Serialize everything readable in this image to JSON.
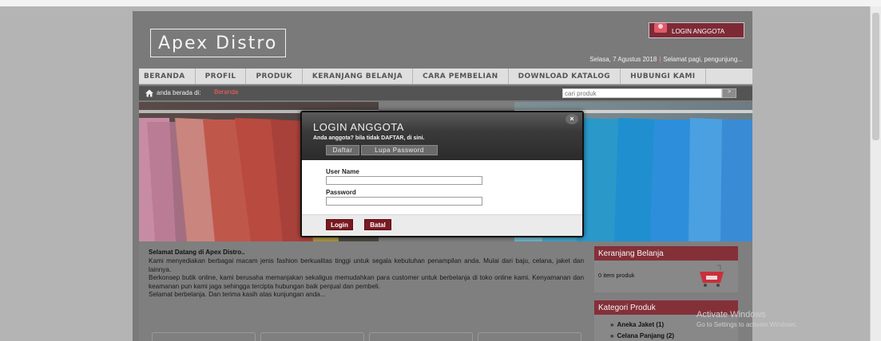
{
  "header": {
    "logo_text": "Apex Distro",
    "login_link": "LOGIN ANGGOTA",
    "date_text": "Selasa, 7 Agustus 2018",
    "greeting": "Selamat pagi, pengunjung..."
  },
  "nav": {
    "items": [
      "BERANDA",
      "PROFIL",
      "PRODUK",
      "KERANJANG BELANJA",
      "CARA PEMBELIAN",
      "DOWNLOAD KATALOG",
      "HUBUNGI KAMI"
    ]
  },
  "breadcrumb": {
    "label": "anda berada di:",
    "current": "Beranda"
  },
  "search": {
    "placeholder": "cari produk",
    "button": ">"
  },
  "modal": {
    "title": "LOGIN ANGGOTA",
    "subtitle": "Anda anggota? bila tidak DAFTAR, di sini.",
    "tab_daftar": "Daftar",
    "tab_lupa": "Lupa Password",
    "close": "×",
    "username_label": "User Name",
    "password_label": "Password",
    "login_button": "Login",
    "cancel_button": "Batal"
  },
  "welcome": {
    "title": "Selamat Datang di  Apex Distro..",
    "p1": "Kami menyediakan berbagai macam jenis fashion berkualitas tinggi untuk segala kebutuhan penampilan anda. Mulai dari baju, celana, jaket dan lainnya.",
    "p2": "Berkonsep butik online, kami berusaha memanjakan sekaligus memudahkan para customer untuk berbelanja di toko online kami. Kenyamanan dan keamanan pun kami jaga sehingga tercipta hubungan baik penjual dan pembeli.",
    "p3": "Selamat berbelanja. Dan terima kasih atas kunjungan anda..."
  },
  "cart": {
    "title": "Keranjang Belanja",
    "items_text": "0 item produk"
  },
  "categories": {
    "title": "Kategori Produk",
    "items": [
      "Aneka Jaket (1)",
      "Celana Panjang (2)"
    ]
  },
  "watermark": {
    "line1": "Activate Windows",
    "line2": "Go to Settings to activate Windows."
  },
  "icons": {
    "home": "home-icon",
    "cart": "cart-icon",
    "login": "login-icon",
    "close": "close-icon"
  },
  "colors": {
    "accent": "#843039",
    "link": "#ff5a5a",
    "button": "#7a1a22"
  }
}
